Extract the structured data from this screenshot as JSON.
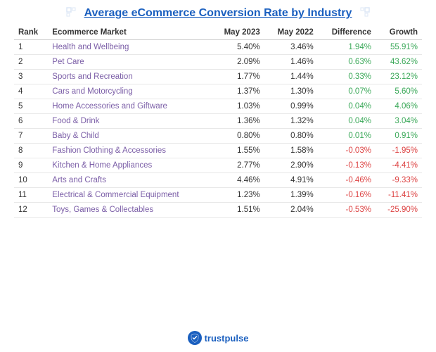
{
  "title": "Average eCommerce Conversion Rate by Industry",
  "columns": [
    "Rank",
    "Ecommerce Market",
    "May 2023",
    "May 2022",
    "Difference",
    "Growth"
  ],
  "rows": [
    {
      "rank": "1",
      "market": "Health and Wellbeing",
      "may2023": "5.40%",
      "may2022": "3.46%",
      "diff": "1.94%",
      "growth": "55.91%",
      "diffType": "positive",
      "growthType": "positive"
    },
    {
      "rank": "2",
      "market": "Pet Care",
      "may2023": "2.09%",
      "may2022": "1.46%",
      "diff": "0.63%",
      "growth": "43.62%",
      "diffType": "positive",
      "growthType": "positive"
    },
    {
      "rank": "3",
      "market": "Sports and Recreation",
      "may2023": "1.77%",
      "may2022": "1.44%",
      "diff": "0.33%",
      "growth": "23.12%",
      "diffType": "positive",
      "growthType": "positive"
    },
    {
      "rank": "4",
      "market": "Cars and Motorcycling",
      "may2023": "1.37%",
      "may2022": "1.30%",
      "diff": "0.07%",
      "growth": "5.60%",
      "diffType": "positive",
      "growthType": "positive"
    },
    {
      "rank": "5",
      "market": "Home Accessories and Giftware",
      "may2023": "1.03%",
      "may2022": "0.99%",
      "diff": "0.04%",
      "growth": "4.06%",
      "diffType": "positive",
      "growthType": "positive"
    },
    {
      "rank": "6",
      "market": "Food & Drink",
      "may2023": "1.36%",
      "may2022": "1.32%",
      "diff": "0.04%",
      "growth": "3.04%",
      "diffType": "positive",
      "growthType": "positive"
    },
    {
      "rank": "7",
      "market": "Baby & Child",
      "may2023": "0.80%",
      "may2022": "0.80%",
      "diff": "0.01%",
      "growth": "0.91%",
      "diffType": "positive",
      "growthType": "positive"
    },
    {
      "rank": "8",
      "market": "Fashion Clothing & Accessories",
      "may2023": "1.55%",
      "may2022": "1.58%",
      "diff": "-0.03%",
      "growth": "-1.95%",
      "diffType": "negative",
      "growthType": "negative"
    },
    {
      "rank": "9",
      "market": "Kitchen & Home Appliances",
      "may2023": "2.77%",
      "may2022": "2.90%",
      "diff": "-0.13%",
      "growth": "-4.41%",
      "diffType": "negative",
      "growthType": "negative"
    },
    {
      "rank": "10",
      "market": "Arts and Crafts",
      "may2023": "4.46%",
      "may2022": "4.91%",
      "diff": "-0.46%",
      "growth": "-9.33%",
      "diffType": "negative",
      "growthType": "negative"
    },
    {
      "rank": "11",
      "market": "Electrical & Commercial Equipment",
      "may2023": "1.23%",
      "may2022": "1.39%",
      "diff": "-0.16%",
      "growth": "-11.41%",
      "diffType": "negative",
      "growthType": "negative"
    },
    {
      "rank": "12",
      "market": "Toys, Games & Collectables",
      "may2023": "1.51%",
      "may2022": "2.04%",
      "diff": "-0.53%",
      "growth": "-25.90%",
      "diffType": "negative",
      "growthType": "negative"
    }
  ],
  "footer": {
    "brand": "trustpulse",
    "checkmark": "✓"
  }
}
